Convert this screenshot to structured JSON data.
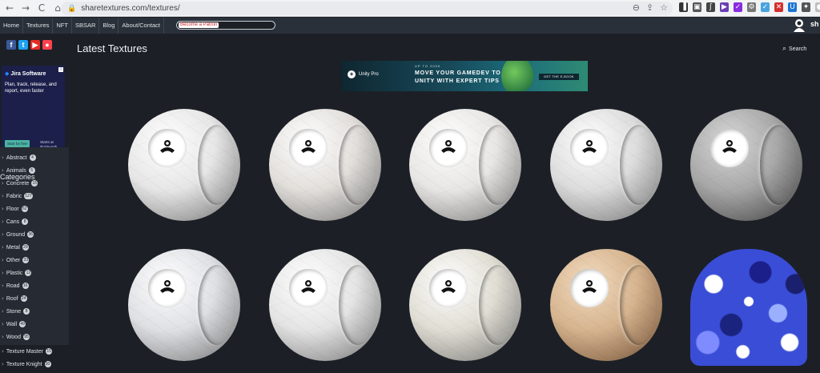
{
  "browser": {
    "url": "sharetextures.com/textures/",
    "nav_back": "←",
    "nav_forward": "→",
    "nav_reload": "C",
    "nav_home": "⌂",
    "lock": "🔒",
    "zoom": "⊖",
    "share": "⇪",
    "star": "☆",
    "extensions": [
      {
        "name": "ext-bookmark-icon",
        "glyph": "▐",
        "color": "#333333"
      },
      {
        "name": "ext-square-icon",
        "glyph": "▣",
        "color": "#555555"
      },
      {
        "name": "ext-script-icon",
        "glyph": "ʃ",
        "color": "#444444"
      },
      {
        "name": "ext-play-icon",
        "glyph": "▶",
        "color": "#6a3fb5"
      },
      {
        "name": "ext-checkmark-icon",
        "glyph": "✓",
        "color": "#8a2be2"
      },
      {
        "name": "ext-gear-icon",
        "glyph": "⚙",
        "color": "#777777"
      },
      {
        "name": "ext-check-icon",
        "glyph": "✓",
        "color": "#4aa3df"
      },
      {
        "name": "ext-close-icon",
        "glyph": "✕",
        "color": "#d32f2f"
      },
      {
        "name": "ext-u-icon",
        "glyph": "U",
        "color": "#1976d2"
      },
      {
        "name": "ext-puzzle-icon",
        "glyph": "✦",
        "color": "#555555"
      },
      {
        "name": "ext-profile-icon",
        "glyph": "●",
        "color": "#bdbdbd"
      }
    ]
  },
  "sitenav": {
    "items": [
      "Home",
      "Textures",
      "NFT",
      "SBSAR",
      "Blog",
      "About/Contact"
    ],
    "badge": "Become a Patron",
    "user": "sh"
  },
  "sidebar": {
    "social": [
      {
        "name": "facebook-icon",
        "glyph": "f",
        "color": "#3b5998"
      },
      {
        "name": "twitter-icon",
        "glyph": "t",
        "color": "#1da1f2"
      },
      {
        "name": "youtube-icon",
        "glyph": "▶",
        "color": "#e52d27"
      },
      {
        "name": "patreon-icon",
        "glyph": "●",
        "color": "#ff424d"
      }
    ],
    "ad": {
      "brand": "Jira Software",
      "copy": "Plan, track, release, and report, even faster",
      "cta": "Start for free",
      "price": "Starts at $10/month"
    },
    "categories_title": "Categories",
    "categories": [
      {
        "label": "Abstract",
        "count": "4"
      },
      {
        "label": "Animals",
        "count": "5"
      },
      {
        "label": "Concrete",
        "count": "15"
      },
      {
        "label": "Fabric",
        "count": "127"
      },
      {
        "label": "Floor",
        "count": "62"
      },
      {
        "label": "Cans",
        "count": "8"
      },
      {
        "label": "Ground",
        "count": "36"
      },
      {
        "label": "Metal",
        "count": "29"
      },
      {
        "label": "Other",
        "count": "33"
      },
      {
        "label": "Plastic",
        "count": "12"
      },
      {
        "label": "Road",
        "count": "16"
      },
      {
        "label": "Roof",
        "count": "24"
      },
      {
        "label": "Stone",
        "count": "8"
      },
      {
        "label": "Wall",
        "count": "49"
      },
      {
        "label": "Wood",
        "count": "95"
      },
      {
        "label": "Texture Master",
        "count": "15"
      },
      {
        "label": "Texture Knight",
        "count": "30"
      }
    ]
  },
  "main": {
    "title": "Latest Textures",
    "search": "Search",
    "banner": {
      "logo": "Unity Pro",
      "eyebrow": "UP TO 200K",
      "headline_line1": "MOVE YOUR GAMEDEV TO",
      "headline_line2": "UNITY WITH EXPERT TIPS",
      "button": "GET THE E-BOOK"
    },
    "textures": [
      {
        "name": "white-plaster",
        "color": "#e6e6e6"
      },
      {
        "name": "white-marble",
        "color": "#e2dfdb"
      },
      {
        "name": "light-marble",
        "color": "#e8e6e4"
      },
      {
        "name": "grey-marble",
        "color": "#dcdcdc"
      },
      {
        "name": "dark-concrete",
        "color": "#a8a8a8"
      },
      {
        "name": "cracked-tile",
        "color": "#dfe0e4"
      },
      {
        "name": "stone-tile",
        "color": "#e4e4e4"
      },
      {
        "name": "light-wood",
        "color": "#e0ddd3"
      },
      {
        "name": "tan-marble",
        "color": "#d6b48f"
      },
      {
        "name": "blue-camo",
        "color": "#3a4dd6"
      }
    ]
  }
}
